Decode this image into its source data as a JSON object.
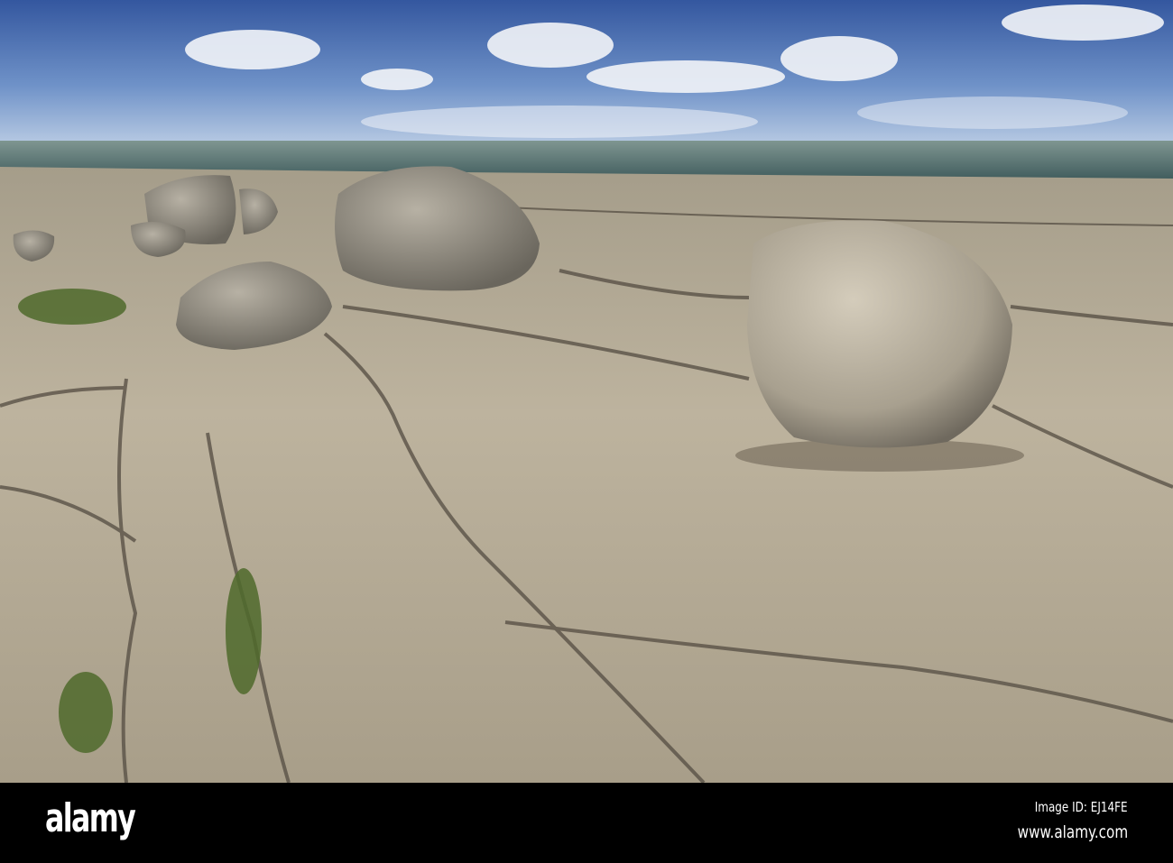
{
  "watermark": {
    "logo": "alamy",
    "image_id": "Image ID: EJ14FE",
    "website": "www.alamy.com"
  },
  "colors": {
    "sky_top": "#3a5fa8",
    "sky_bottom": "#a9c1e0",
    "sea": "#4e6b68",
    "rock": "#b7ad98",
    "bar": "#000000"
  }
}
